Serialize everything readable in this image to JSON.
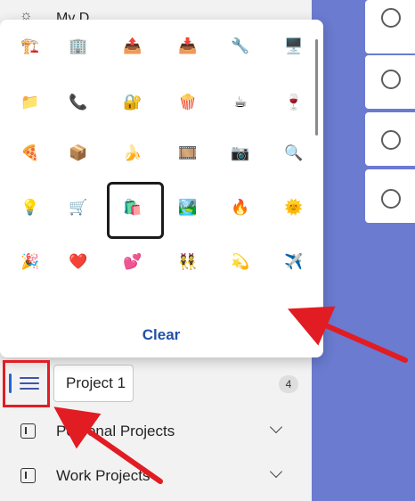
{
  "sidebar": {
    "peek_item": {
      "label": "My D"
    },
    "project_row": {
      "name_input_value": "Project 1",
      "count": "4"
    },
    "groups": [
      {
        "label": "Personal Projects"
      },
      {
        "label": "Work Projects"
      }
    ]
  },
  "emoji_picker": {
    "rows": [
      [
        "🏗️",
        "🏢",
        "📤",
        "📥",
        "🔧",
        "🖥️"
      ],
      [
        "📁",
        "📞",
        "🔐",
        "🍿",
        "☕",
        "🍷"
      ],
      [
        "🍕",
        "📦",
        "🍌",
        "🎞️",
        "📷",
        "🔍"
      ],
      [
        "💡",
        "🛒",
        "🛍️",
        "🏞️",
        "🔥",
        "🌞"
      ],
      [
        "🎉",
        "❤️",
        "💕",
        "👯",
        "💫",
        "✈️"
      ]
    ],
    "selected": "🛍️",
    "clear_label": "Clear"
  },
  "colors": {
    "accent": "#2564cf",
    "annotation_red": "#e21c23",
    "main_background": "#6a7bd0"
  }
}
